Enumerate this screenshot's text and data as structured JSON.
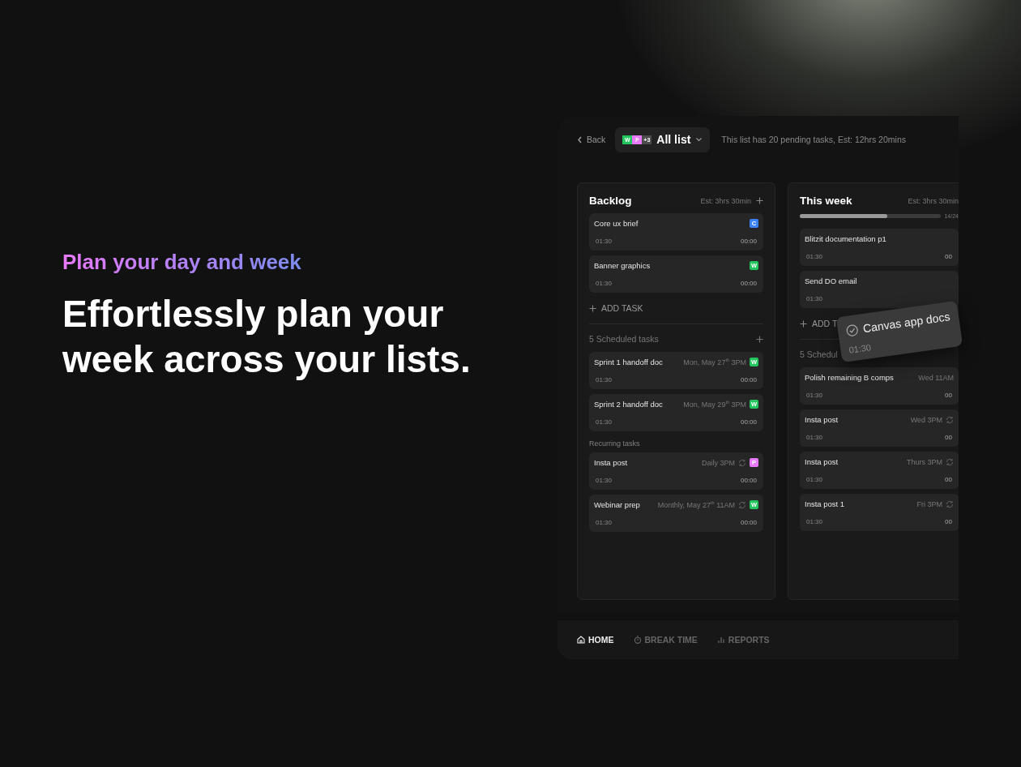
{
  "hero": {
    "eyebrow": "Plan your day and week",
    "headline": "Effortlessly plan your week across your lists."
  },
  "app": {
    "back": "Back",
    "list_selector": {
      "badges": [
        {
          "label": "W",
          "color": "#22c55e"
        },
        {
          "label": "P",
          "color": "#e879f9"
        },
        {
          "label": "+3",
          "color": "#4b4b4b"
        }
      ],
      "title": "All list"
    },
    "summary": "This list has 20 pending tasks, Est: 12hrs 20mins",
    "columns": [
      {
        "title": "Backlog",
        "estimate": "Est: 3hrs 30min",
        "add_button": true,
        "tasks": [
          {
            "title": "Core ux brief",
            "tag": {
              "label": "C",
              "color": "#3b82f6"
            },
            "estimate": "01:30",
            "elapsed": "00:00"
          },
          {
            "title": "Banner graphics",
            "tag": {
              "label": "W",
              "color": "#22c55e"
            },
            "estimate": "01:30",
            "elapsed": "00:00"
          }
        ],
        "add_task": "ADD TASK",
        "scheduled_header": "5 Scheduled tasks",
        "scheduled": [
          {
            "title": "Sprint 1 handoff doc",
            "when": "Mon, May 27$^{th}$ 3PM",
            "tag": {
              "label": "W",
              "color": "#22c55e"
            },
            "estimate": "01:30",
            "elapsed": "00:00"
          },
          {
            "title": "Sprint 2 handoff doc",
            "when": "Mon, May 29$^{th}$ 3PM",
            "tag": {
              "label": "W",
              "color": "#22c55e"
            },
            "estimate": "01:30",
            "elapsed": "00:00"
          }
        ],
        "recurring_header": "Recurring tasks",
        "recurring": [
          {
            "title": "Insta post",
            "when": "Daily 3PM",
            "repeat": true,
            "tag": {
              "label": "P",
              "color": "#e879f9"
            },
            "estimate": "01:30",
            "elapsed": "00:00"
          },
          {
            "title": "Webinar prep",
            "when": "Monthly, May 27$^{th}$ 11AM",
            "repeat": true,
            "tag": {
              "label": "W",
              "color": "#22c55e"
            },
            "estimate": "01:30",
            "elapsed": "00:00"
          }
        ]
      },
      {
        "title": "This week",
        "estimate": "Est: 3hrs 30min",
        "add_button": false,
        "progress": {
          "level": 0.62,
          "label": "14/24"
        },
        "tasks": [
          {
            "title": "Blitzit documentation p1",
            "estimate": "01:30",
            "elapsed": "00"
          },
          {
            "title": "Send DO email",
            "estimate": "01:30"
          }
        ],
        "add_task": "ADD T",
        "scheduled_header": "5 Schedul",
        "scheduled": [
          {
            "title": "Polish remaining B comps",
            "when": "Wed 11AM",
            "estimate": "01:30",
            "elapsed": "00"
          },
          {
            "title": "Insta post",
            "when": "Wed 3PM",
            "repeat": true,
            "estimate": "01:30",
            "elapsed": "00"
          },
          {
            "title": "Insta post",
            "when": "Thurs 3PM",
            "repeat": true,
            "estimate": "01:30",
            "elapsed": "00"
          },
          {
            "title": "Insta post 1",
            "when": "Fri 3PM",
            "repeat": true,
            "estimate": "01:30",
            "elapsed": "00"
          }
        ]
      }
    ],
    "drag_card": {
      "title": "Canvas app docs",
      "time": "01:30"
    },
    "nav": [
      {
        "label": "HOME",
        "selected": true
      },
      {
        "label": "BREAK TIME",
        "selected": false
      },
      {
        "label": "REPORTS",
        "selected": false
      }
    ]
  }
}
